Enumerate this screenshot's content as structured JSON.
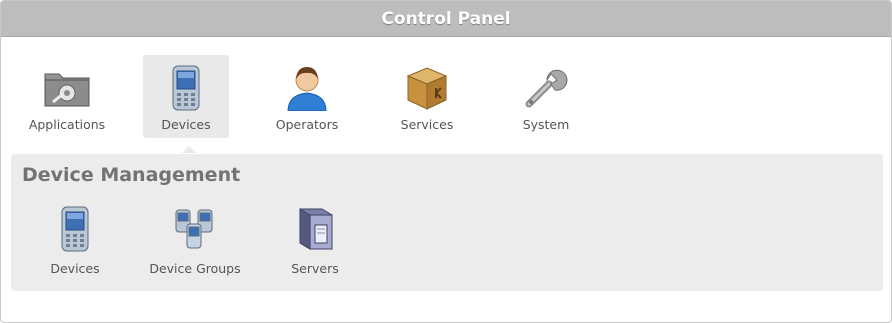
{
  "window": {
    "title": "Control Panel"
  },
  "top_nav": {
    "items": [
      {
        "label": "Applications",
        "icon": "applications-folder-gear-icon",
        "selected": false
      },
      {
        "label": "Devices",
        "icon": "pda-device-icon",
        "selected": true
      },
      {
        "label": "Operators",
        "icon": "operator-person-icon",
        "selected": false
      },
      {
        "label": "Services",
        "icon": "services-box-icon",
        "selected": false
      },
      {
        "label": "System",
        "icon": "wrench-icon",
        "selected": false
      }
    ]
  },
  "section": {
    "title": "Device Management",
    "items": [
      {
        "label": "Devices",
        "icon": "pda-device-icon"
      },
      {
        "label": "Device Groups",
        "icon": "device-group-icon"
      },
      {
        "label": "Servers",
        "icon": "server-icon"
      }
    ]
  },
  "colors": {
    "titlebar_bg": "#bdbdbd",
    "selected_bg": "#e9e9e9",
    "section_bg": "#ececec",
    "title_text": "#ffffff",
    "label_text": "#555555",
    "section_title": "#737373"
  }
}
